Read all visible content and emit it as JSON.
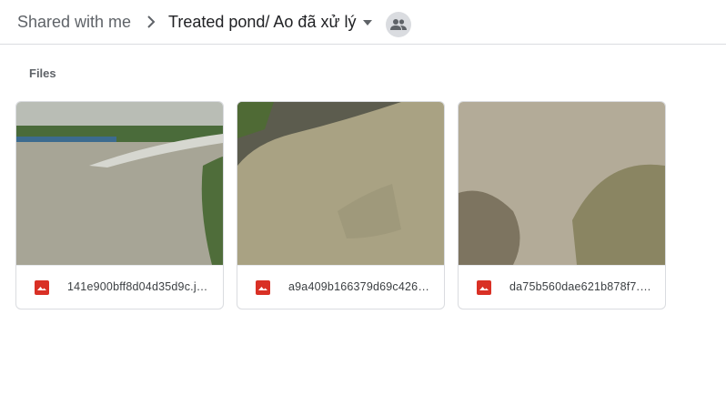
{
  "breadcrumb": {
    "root": "Shared with me",
    "current": "Treated pond/ Ao đã xử lý"
  },
  "section": {
    "label": "Files"
  },
  "files": [
    {
      "name": "141e900bff8d04d35d9c.jpg",
      "display": "141e900bff8d04d35d9c.j…",
      "type_icon": "image-icon"
    },
    {
      "name": "a9a409b166379d69c426.jpg",
      "display": "a9a409b166379d69c426…",
      "type_icon": "image-icon"
    },
    {
      "name": "da75b560dae621b878f7.jpg",
      "display": "da75b560dae621b878f7.…",
      "type_icon": "image-icon"
    }
  ],
  "colors": {
    "file_icon": "#d93025",
    "divider": "#dadce0",
    "text_primary": "#202124",
    "text_secondary": "#5f6368"
  }
}
